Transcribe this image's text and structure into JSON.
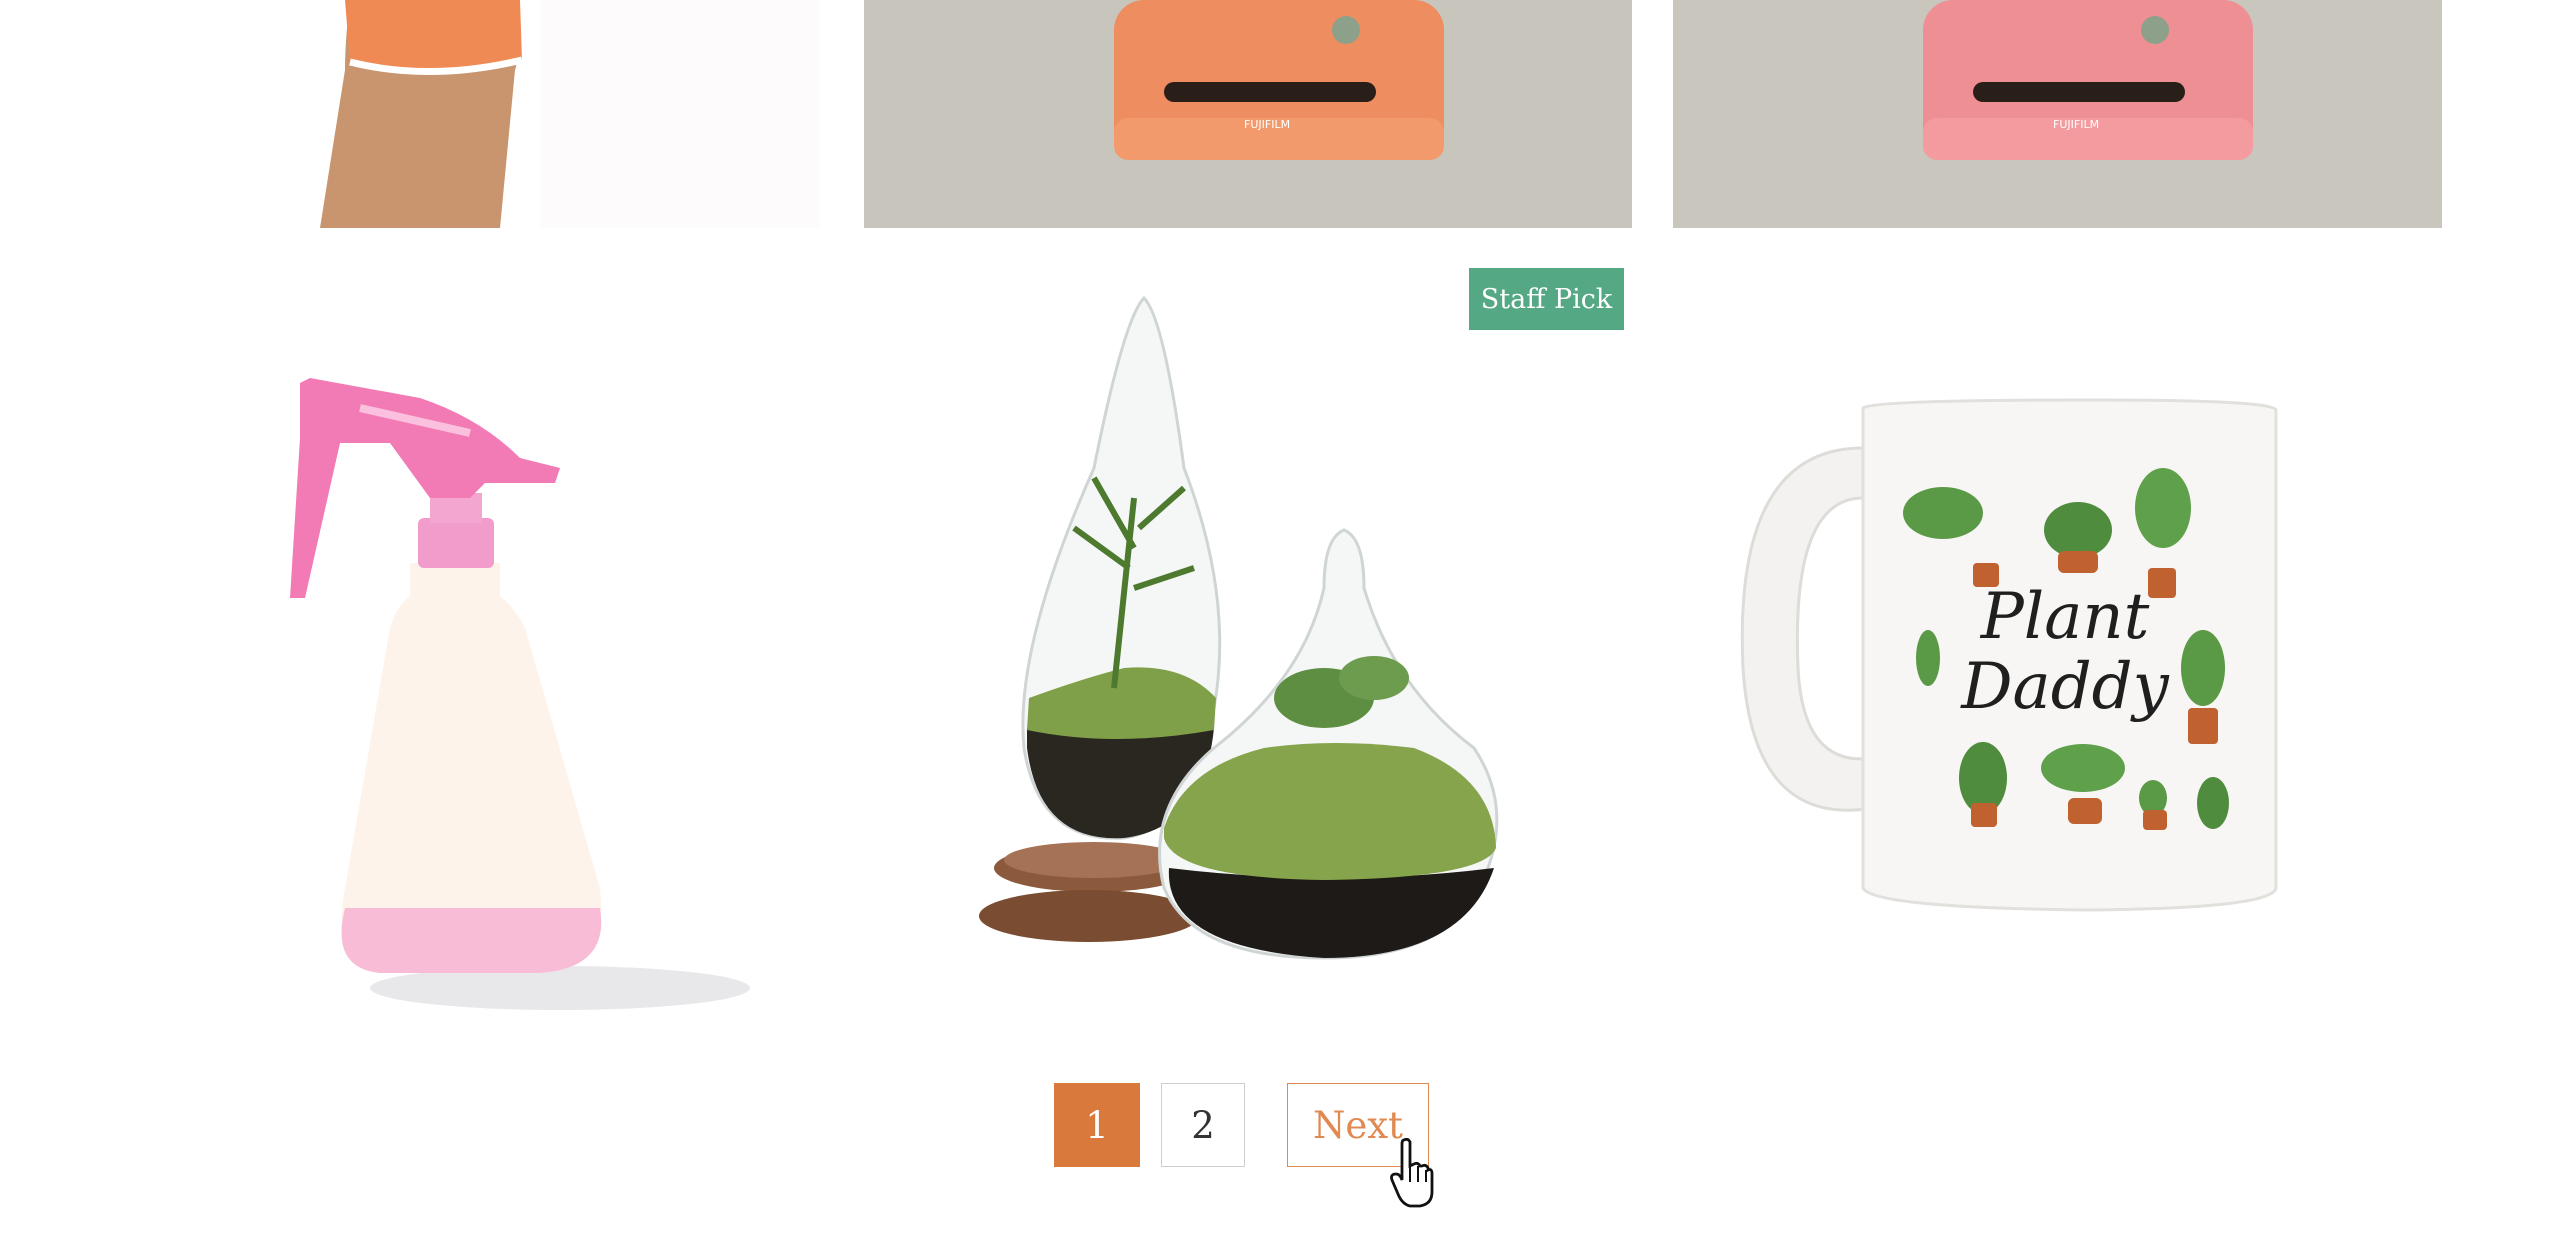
{
  "products": [
    {
      "name": "orange-sleeve-arm",
      "icon": "arm-sleeve-image"
    },
    {
      "name": "instax-camera-orange",
      "icon": "camera-image",
      "brand_text": "FUJIFILM"
    },
    {
      "name": "instax-camera-pink",
      "icon": "camera-image",
      "brand_text": "FUJIFILM"
    },
    {
      "name": "pink-spray-bottle",
      "icon": "spray-bottle-image"
    },
    {
      "name": "glass-terrarium",
      "icon": "terrarium-image",
      "badge": "Staff Pick"
    },
    {
      "name": "plant-daddy-mug",
      "icon": "mug-image",
      "mug_text_line1": "Plant",
      "mug_text_line2": "Daddy"
    }
  ],
  "pagination": {
    "pages": [
      "1",
      "2"
    ],
    "current": "1",
    "next_label": "Next"
  },
  "colors": {
    "accent": "#d97a3c",
    "badge": "#55a884",
    "next_border": "#e08a52"
  }
}
